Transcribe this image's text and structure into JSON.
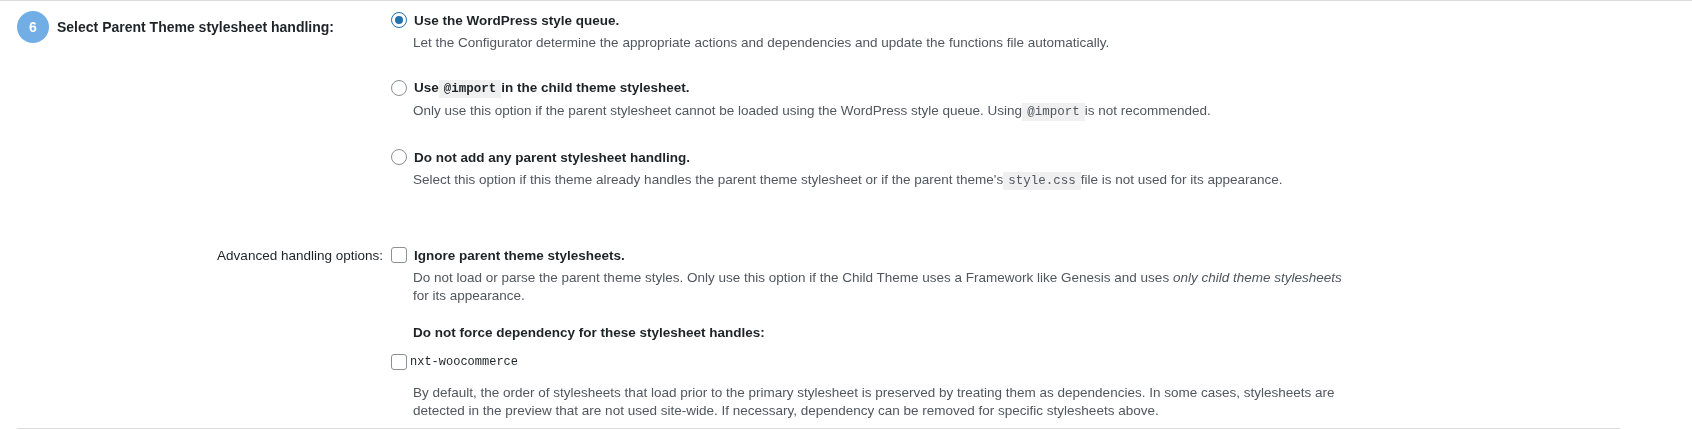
{
  "step": {
    "number": "6",
    "label": "Select Parent Theme stylesheet handling:"
  },
  "handling_options": [
    {
      "selected": true,
      "title": [
        {
          "kind": "text",
          "text": "Use the WordPress style queue."
        }
      ],
      "description": [
        {
          "kind": "text",
          "text": "Let the Configurator determine the appropriate actions and dependencies and update the functions file automatically."
        }
      ]
    },
    {
      "selected": false,
      "title": [
        {
          "kind": "text",
          "text": "Use"
        },
        {
          "kind": "code",
          "text": "@import"
        },
        {
          "kind": "text",
          "text": "in the child theme stylesheet."
        }
      ],
      "description": [
        {
          "kind": "text",
          "text": "Only use this option if the parent stylesheet cannot be loaded using the WordPress style queue. Using"
        },
        {
          "kind": "code",
          "text": "@import"
        },
        {
          "kind": "text",
          "text": "is not recommended."
        }
      ]
    },
    {
      "selected": false,
      "title": [
        {
          "kind": "text",
          "text": "Do not add any parent stylesheet handling."
        }
      ],
      "description": [
        {
          "kind": "text",
          "text": "Select this option if this theme already handles the parent theme stylesheet or if the parent theme's"
        },
        {
          "kind": "code",
          "text": "style.css"
        },
        {
          "kind": "text",
          "text": "file is not used for its appearance."
        }
      ]
    }
  ],
  "advanced": {
    "label": "Advanced handling options:",
    "ignore_parent": {
      "checked": false,
      "title": "Ignore parent theme stylesheets.",
      "description": "Do not load or parse the parent theme styles. Only use this option if the Child Theme uses a Framework like Genesis and uses *only child theme stylesheets* for its appearance."
    },
    "dependency_heading": "Do not force dependency for these stylesheet handles:",
    "handles": [
      {
        "name": "nxt-woocommerce",
        "checked": false
      }
    ],
    "dependency_note": "By default, the order of stylesheets that load prior to the primary stylesheet is preserved by treating them as dependencies. In some cases, stylesheets are detected in the preview that are not used site-wide. If necessary, dependency can be removed for specific stylesheets above."
  }
}
